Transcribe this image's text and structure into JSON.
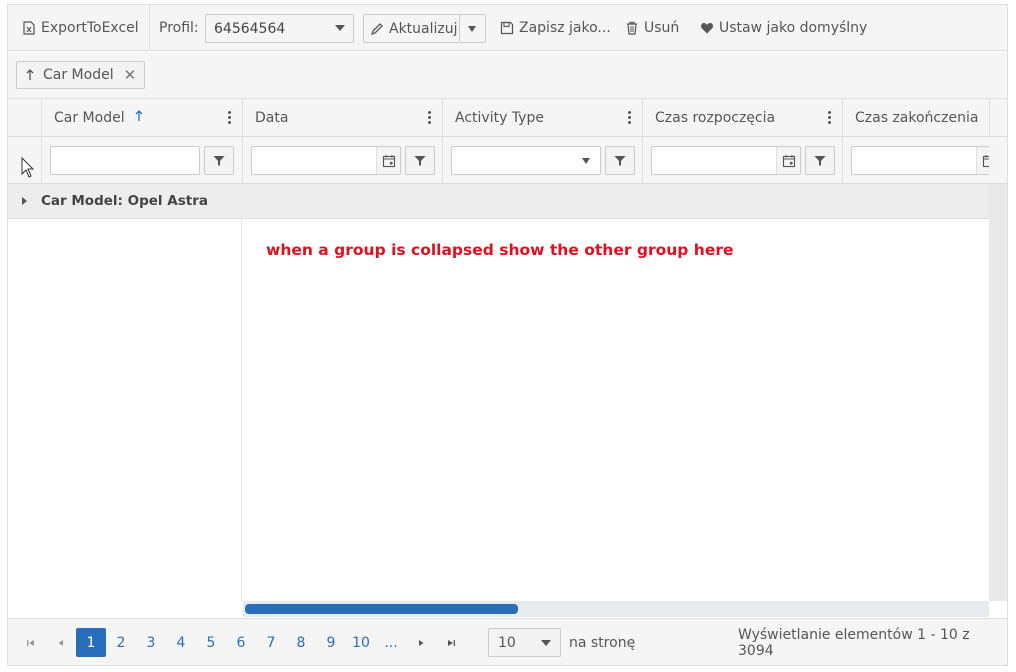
{
  "toolbar": {
    "export_label": "ExportToExcel",
    "profile_label": "Profil:",
    "profile_value": "64564564",
    "update_label": "Aktualizuj",
    "save_as_label": "Zapisz jako...",
    "delete_label": "Usuń",
    "set_default_label": "Ustaw jako domyślny"
  },
  "grouping": {
    "chip_label": "Car Model"
  },
  "columns": [
    {
      "label": "Car Model"
    },
    {
      "label": "Data"
    },
    {
      "label": "Activity Type"
    },
    {
      "label": "Czas rozpoczęcia"
    },
    {
      "label": "Czas zakończenia"
    }
  ],
  "group_row": {
    "label": "Car Model: Opel Astra"
  },
  "note": "when a group is collapsed show the other group here",
  "pager": {
    "pages": [
      "1",
      "2",
      "3",
      "4",
      "5",
      "6",
      "7",
      "8",
      "9",
      "10",
      "..."
    ],
    "current_page": "1",
    "page_size": "10",
    "per_page_label": "na stronę",
    "info": "Wyświetlanie elementów 1 - 10 z 3094"
  },
  "colors": {
    "accent": "#2a6ebb",
    "note_text": "#e0101e"
  }
}
